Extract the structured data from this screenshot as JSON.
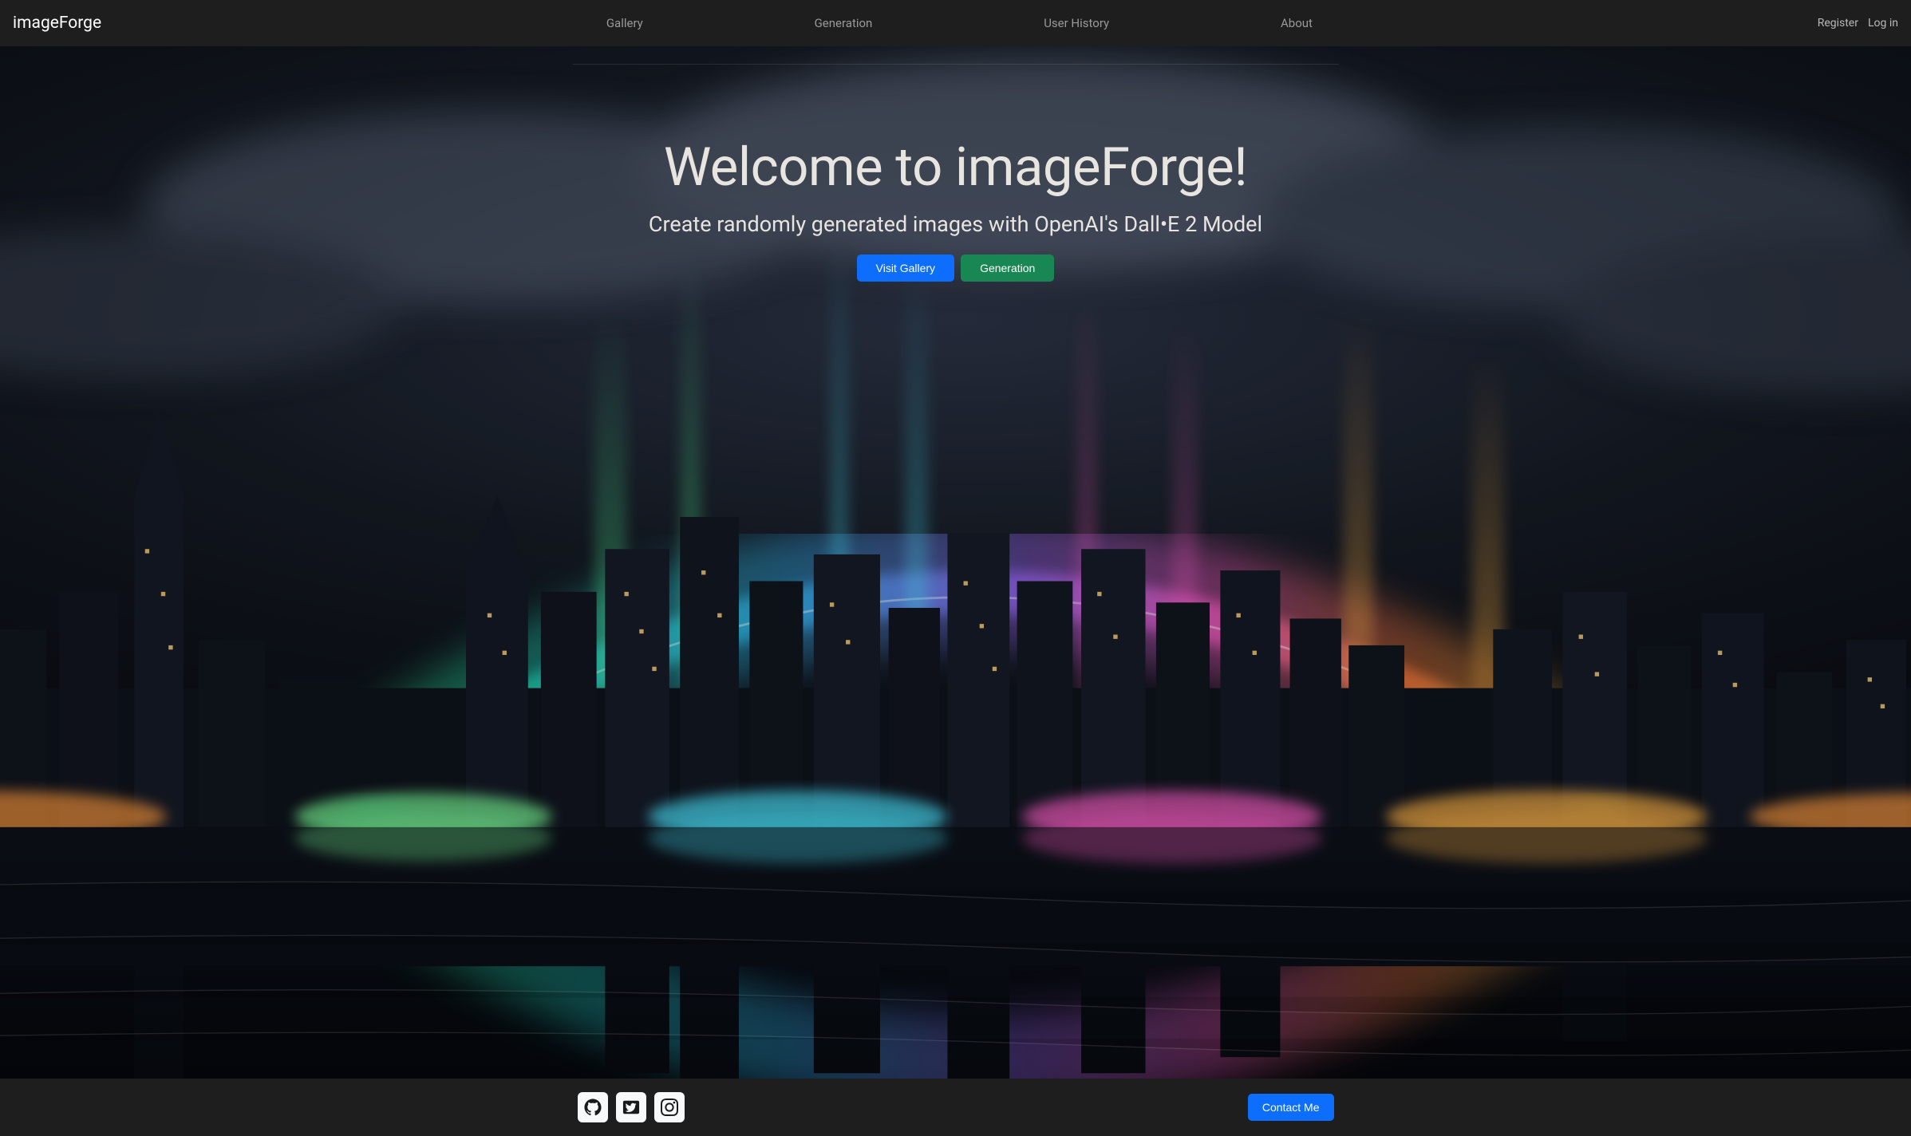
{
  "navbar": {
    "brand": "imageForge",
    "links": {
      "gallery": "Gallery",
      "generation": "Generation",
      "user_history": "User History",
      "about": "About"
    },
    "auth": {
      "register": "Register",
      "login": "Log in"
    }
  },
  "hero": {
    "title": "Welcome to imageForge!",
    "subtitle": "Create randomly generated images with OpenAI's Dall•E 2 Model",
    "buttons": {
      "visit_gallery": "Visit Gallery",
      "generation": "Generation"
    }
  },
  "footer": {
    "contact_label": "Contact Me",
    "social": {
      "github": "github-icon",
      "twitter": "twitter-icon",
      "instagram": "instagram-icon"
    }
  }
}
